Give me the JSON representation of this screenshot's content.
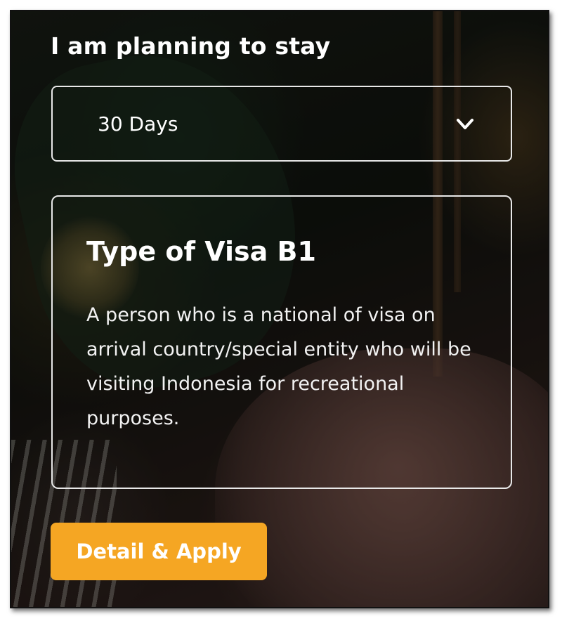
{
  "stay": {
    "label": "I am planning to stay",
    "selected_duration": "30 Days",
    "dropdown_icon": "chevron-down-icon"
  },
  "visa_card": {
    "title": "Type of Visa B1",
    "description": "A person who is a national of visa on arrival country/special entity who will be visiting Indonesia for recreational purposes."
  },
  "actions": {
    "apply_label": "Detail & Apply"
  },
  "colors": {
    "accent": "#f5a623",
    "text": "#ffffff",
    "border": "#e8e8e8"
  }
}
